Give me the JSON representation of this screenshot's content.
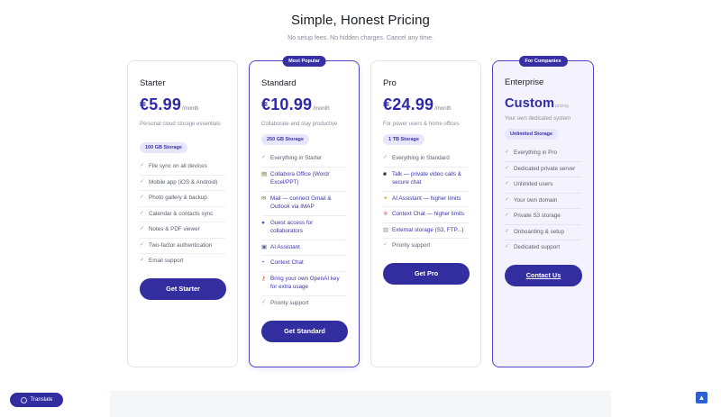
{
  "header": {
    "title": "Simple, Honest Pricing",
    "subtitle": "No setup fees. No hidden charges. Cancel any time."
  },
  "plans": [
    {
      "name": "Starter",
      "price": "€5.99",
      "period": "/month",
      "description": "Personal cloud storage essentials",
      "storage": "100 GB Storage",
      "features": [
        {
          "icon": "check",
          "text": "File sync on all devices"
        },
        {
          "icon": "check",
          "text": "Mobile app (iOS & Android)"
        },
        {
          "icon": "check",
          "text": "Photo gallery & backup"
        },
        {
          "icon": "check",
          "text": "Calendar & contacts sync"
        },
        {
          "icon": "check",
          "text": "Notes & PDF viewer"
        },
        {
          "icon": "check",
          "text": "Two-factor authentication"
        },
        {
          "icon": "check",
          "text": "Email support"
        }
      ],
      "cta": "Get Starter"
    },
    {
      "name": "Standard",
      "badge": "Most Popular",
      "price": "€10.99",
      "period": "/month",
      "description": "Collaborate and stay productive",
      "storage": "250 GB Storage",
      "features": [
        {
          "icon": "check",
          "text": "Everything in  Starter"
        },
        {
          "icon": "document-icon",
          "text": "Collabora Office (Word/ Excel/PPT)"
        },
        {
          "icon": "mail-icon",
          "text": "Mail — connect Gmail & Outlook via IMAP"
        },
        {
          "icon": "guest-icon",
          "text": "Guest access for collaborators"
        },
        {
          "icon": "robot-icon",
          "text": "AI Assistant"
        },
        {
          "icon": "chat-icon",
          "text": "Context Chat"
        },
        {
          "icon": "key-icon",
          "text": "Bring your own OpenAI key for extra usage"
        },
        {
          "icon": "check",
          "text": "Priority support"
        }
      ],
      "cta": "Get Standard"
    },
    {
      "name": "Pro",
      "price": "€24.99",
      "period": "/month",
      "description": "For power users & home offices",
      "storage": "1 TB Storage",
      "features": [
        {
          "icon": "check",
          "text": "Everything in  Standard"
        },
        {
          "icon": "video-icon",
          "text": "Talk — private video calls & secure chat"
        },
        {
          "icon": "sparkle-icon",
          "text": "AI Assistant — higher limits"
        },
        {
          "icon": "brain-icon",
          "text": "Context Chat — higher limits"
        },
        {
          "icon": "storage-icon",
          "text": "External storage (S3, FTP...)"
        },
        {
          "icon": "check",
          "text": "Priority support"
        }
      ],
      "cta": "Get Pro"
    },
    {
      "name": "Enterprise",
      "badge": "For Companies",
      "price": "Custom",
      "period": "pricing",
      "description": "Your own dedicated system",
      "storage": "Unlimited Storage",
      "features": [
        {
          "icon": "check",
          "text": "Everything in  Pro"
        },
        {
          "icon": "check",
          "text": "Dedicated private server"
        },
        {
          "icon": "check",
          "text": "Unlimited users"
        },
        {
          "icon": "check",
          "text": "Your own domain"
        },
        {
          "icon": "check",
          "text": "Private S3 storage"
        },
        {
          "icon": "check",
          "text": "Onboarding & setup"
        },
        {
          "icon": "check",
          "text": "Dedicated support"
        }
      ],
      "cta": "Contact Us"
    }
  ],
  "translate": {
    "label": "Translate"
  },
  "colors": {
    "accent": "#332e9f",
    "badge_bg": "#e8e6fb",
    "enterprise_bg": "#f4f3fd"
  }
}
